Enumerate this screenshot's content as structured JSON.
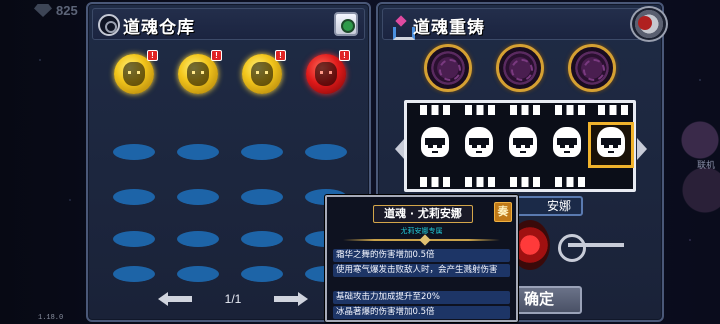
{
  "hud": {
    "currency_icon": "gem-icon",
    "currency_value": "825",
    "version": "1.18.0",
    "side_label": "联机"
  },
  "storage": {
    "title": "道魂仓库",
    "emblem_icon": "soul-emblem-icon",
    "sort_icon": "sort-icon",
    "souls": [
      {
        "color": "gold",
        "badge": "!"
      },
      {
        "color": "gold",
        "badge": "!"
      },
      {
        "color": "gold",
        "badge": "!"
      },
      {
        "color": "red",
        "badge": "!"
      }
    ],
    "empty_slot_rows": 4,
    "slot_color": "#1e6cb4",
    "pager": {
      "current_total": "1/1",
      "prev_icon": "arrow-left-icon",
      "next_icon": "arrow-right-icon"
    }
  },
  "recast": {
    "title": "道魂重铸",
    "title_icon": "recast-icon",
    "back_icon": "back-icon",
    "material_slots": 3,
    "selected_name": "安娜",
    "confirm_label": "确定",
    "accent_gold": "#f1b32c"
  },
  "tooltip": {
    "title": "道魂 · 尤莉安娜",
    "close_label": "奏",
    "subtitle": "尤莉安娜专属",
    "effects": [
      "霜华之舞的伤害增加0.5倍",
      "使用寒气爆发击败敌人时，会产生溅射伤害",
      "基础攻击力加成提升至20%",
      "冰晶著爆的伤害增加0.5倍"
    ]
  }
}
